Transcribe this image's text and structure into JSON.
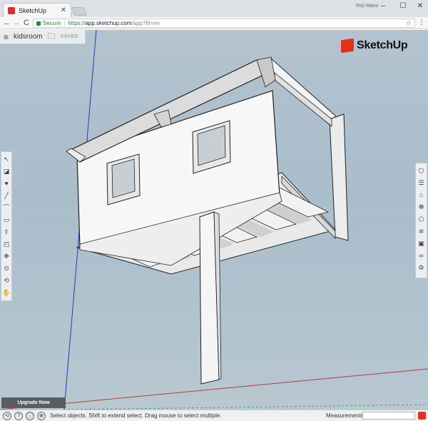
{
  "browser": {
    "tab_title": "SketchUp",
    "tab_close_icon": "close-icon",
    "user_name": "Reji Mano",
    "window_controls": [
      "–",
      "☐",
      "✕"
    ],
    "nav": {
      "back": "←",
      "forward": "→",
      "reload": "C"
    },
    "secure_label": "Secure",
    "separator": "|",
    "url": {
      "protocol": "https://",
      "host": "app.sketchup.com",
      "rest": "/app?hl=en"
    },
    "star": "☆",
    "menu": "⋮"
  },
  "model": {
    "menu_icon": "≡",
    "name": "kidsroom",
    "folder_icon": "🗀",
    "saved_label": "SAVED"
  },
  "logo": {
    "text": "SketchUp"
  },
  "toolbar_left": [
    {
      "name": "select-icon",
      "glyph": "↖"
    },
    {
      "name": "eraser-icon",
      "glyph": "◪"
    },
    {
      "name": "paint-bucket-icon",
      "glyph": "♥"
    },
    {
      "name": "pencil-icon",
      "glyph": "╱"
    },
    {
      "name": "arc-icon",
      "glyph": "⌒"
    },
    {
      "name": "rectangle-icon",
      "glyph": "▭"
    },
    {
      "name": "push-pull-icon",
      "glyph": "⇪"
    },
    {
      "name": "offset-icon",
      "glyph": "◰"
    },
    {
      "name": "move-icon",
      "glyph": "✥"
    },
    {
      "name": "tape-measure-icon",
      "glyph": "⊙"
    },
    {
      "name": "orbit-icon",
      "glyph": "⟲"
    },
    {
      "name": "pan-icon",
      "glyph": "✋"
    }
  ],
  "toolbar_right": [
    {
      "name": "instructor-icon",
      "glyph": "⬡"
    },
    {
      "name": "entity-info-icon",
      "glyph": "☰"
    },
    {
      "name": "components-icon",
      "glyph": "⌂"
    },
    {
      "name": "materials-icon",
      "glyph": "❁"
    },
    {
      "name": "styles-icon",
      "glyph": "⬠"
    },
    {
      "name": "layers-icon",
      "glyph": "≋"
    },
    {
      "name": "scenes-icon",
      "glyph": "▣"
    },
    {
      "name": "display-icon",
      "glyph": "∞"
    },
    {
      "name": "extensions-icon",
      "glyph": "⚙"
    }
  ],
  "upgrade_label": "Upgrade Now",
  "status": {
    "icons": [
      "⟲",
      "?",
      "ⓘ",
      "⊕"
    ],
    "text": "Select objects. Shift to extend select. Drag mouse to select multiple.",
    "measurements_label": "Measurements",
    "measurements_value": ""
  },
  "colors": {
    "sky_top": "#b3c3cf",
    "brand_red": "#e3311d",
    "axis_blue": "#1f3bbf",
    "axis_red": "#b33b3b",
    "axis_green": "#3a9a3a"
  }
}
